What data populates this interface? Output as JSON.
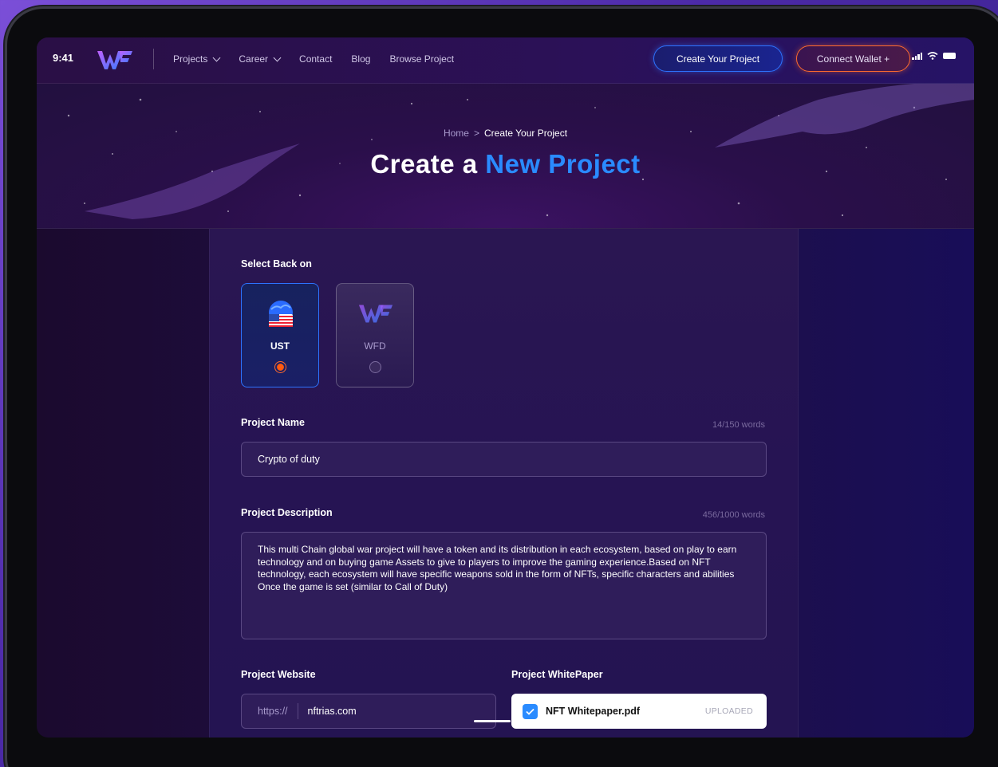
{
  "status": {
    "time": "9:41"
  },
  "nav": {
    "links": [
      {
        "label": "Projects",
        "dropdown": true
      },
      {
        "label": "Career",
        "dropdown": true
      },
      {
        "label": "Contact",
        "dropdown": false
      },
      {
        "label": "Blog",
        "dropdown": false
      },
      {
        "label": "Browse Project",
        "dropdown": false
      }
    ],
    "create_button": "Create Your Project",
    "wallet_button": "Connect Wallet +"
  },
  "hero": {
    "breadcrumb": {
      "home": "Home",
      "separator": ">",
      "current": "Create Your Project"
    },
    "title_white": "Create a",
    "title_blue": "New Project"
  },
  "form": {
    "select_label": "Select Back on",
    "coins": [
      {
        "name": "UST",
        "selected": true
      },
      {
        "name": "WFD",
        "selected": false
      }
    ],
    "project_name": {
      "label": "Project Name",
      "counter": "14/150 words",
      "value": "Crypto of duty"
    },
    "project_description": {
      "label": "Project Description",
      "counter": "456/1000 words",
      "value": "This multi Chain global war project will have a token and its distribution in each ecosystem, based on play to earn technology and on buying game Assets to give to players to improve the gaming experience.Based on NFT technology, each ecosystem will have specific weapons sold in the form of NFTs, specific characters and abilities Once the game is set (similar to Call of Duty)"
    },
    "project_website": {
      "label": "Project Website",
      "prefix": "https://",
      "value": "nftrias.com"
    },
    "project_whitepaper": {
      "label": "Project WhitePaper",
      "file": "NFT Whitepaper.pdf",
      "status": "UPLOADED"
    }
  },
  "colors": {
    "accent_blue": "#2a8bff",
    "accent_orange": "#ff6b2d",
    "background": "#21104a"
  }
}
